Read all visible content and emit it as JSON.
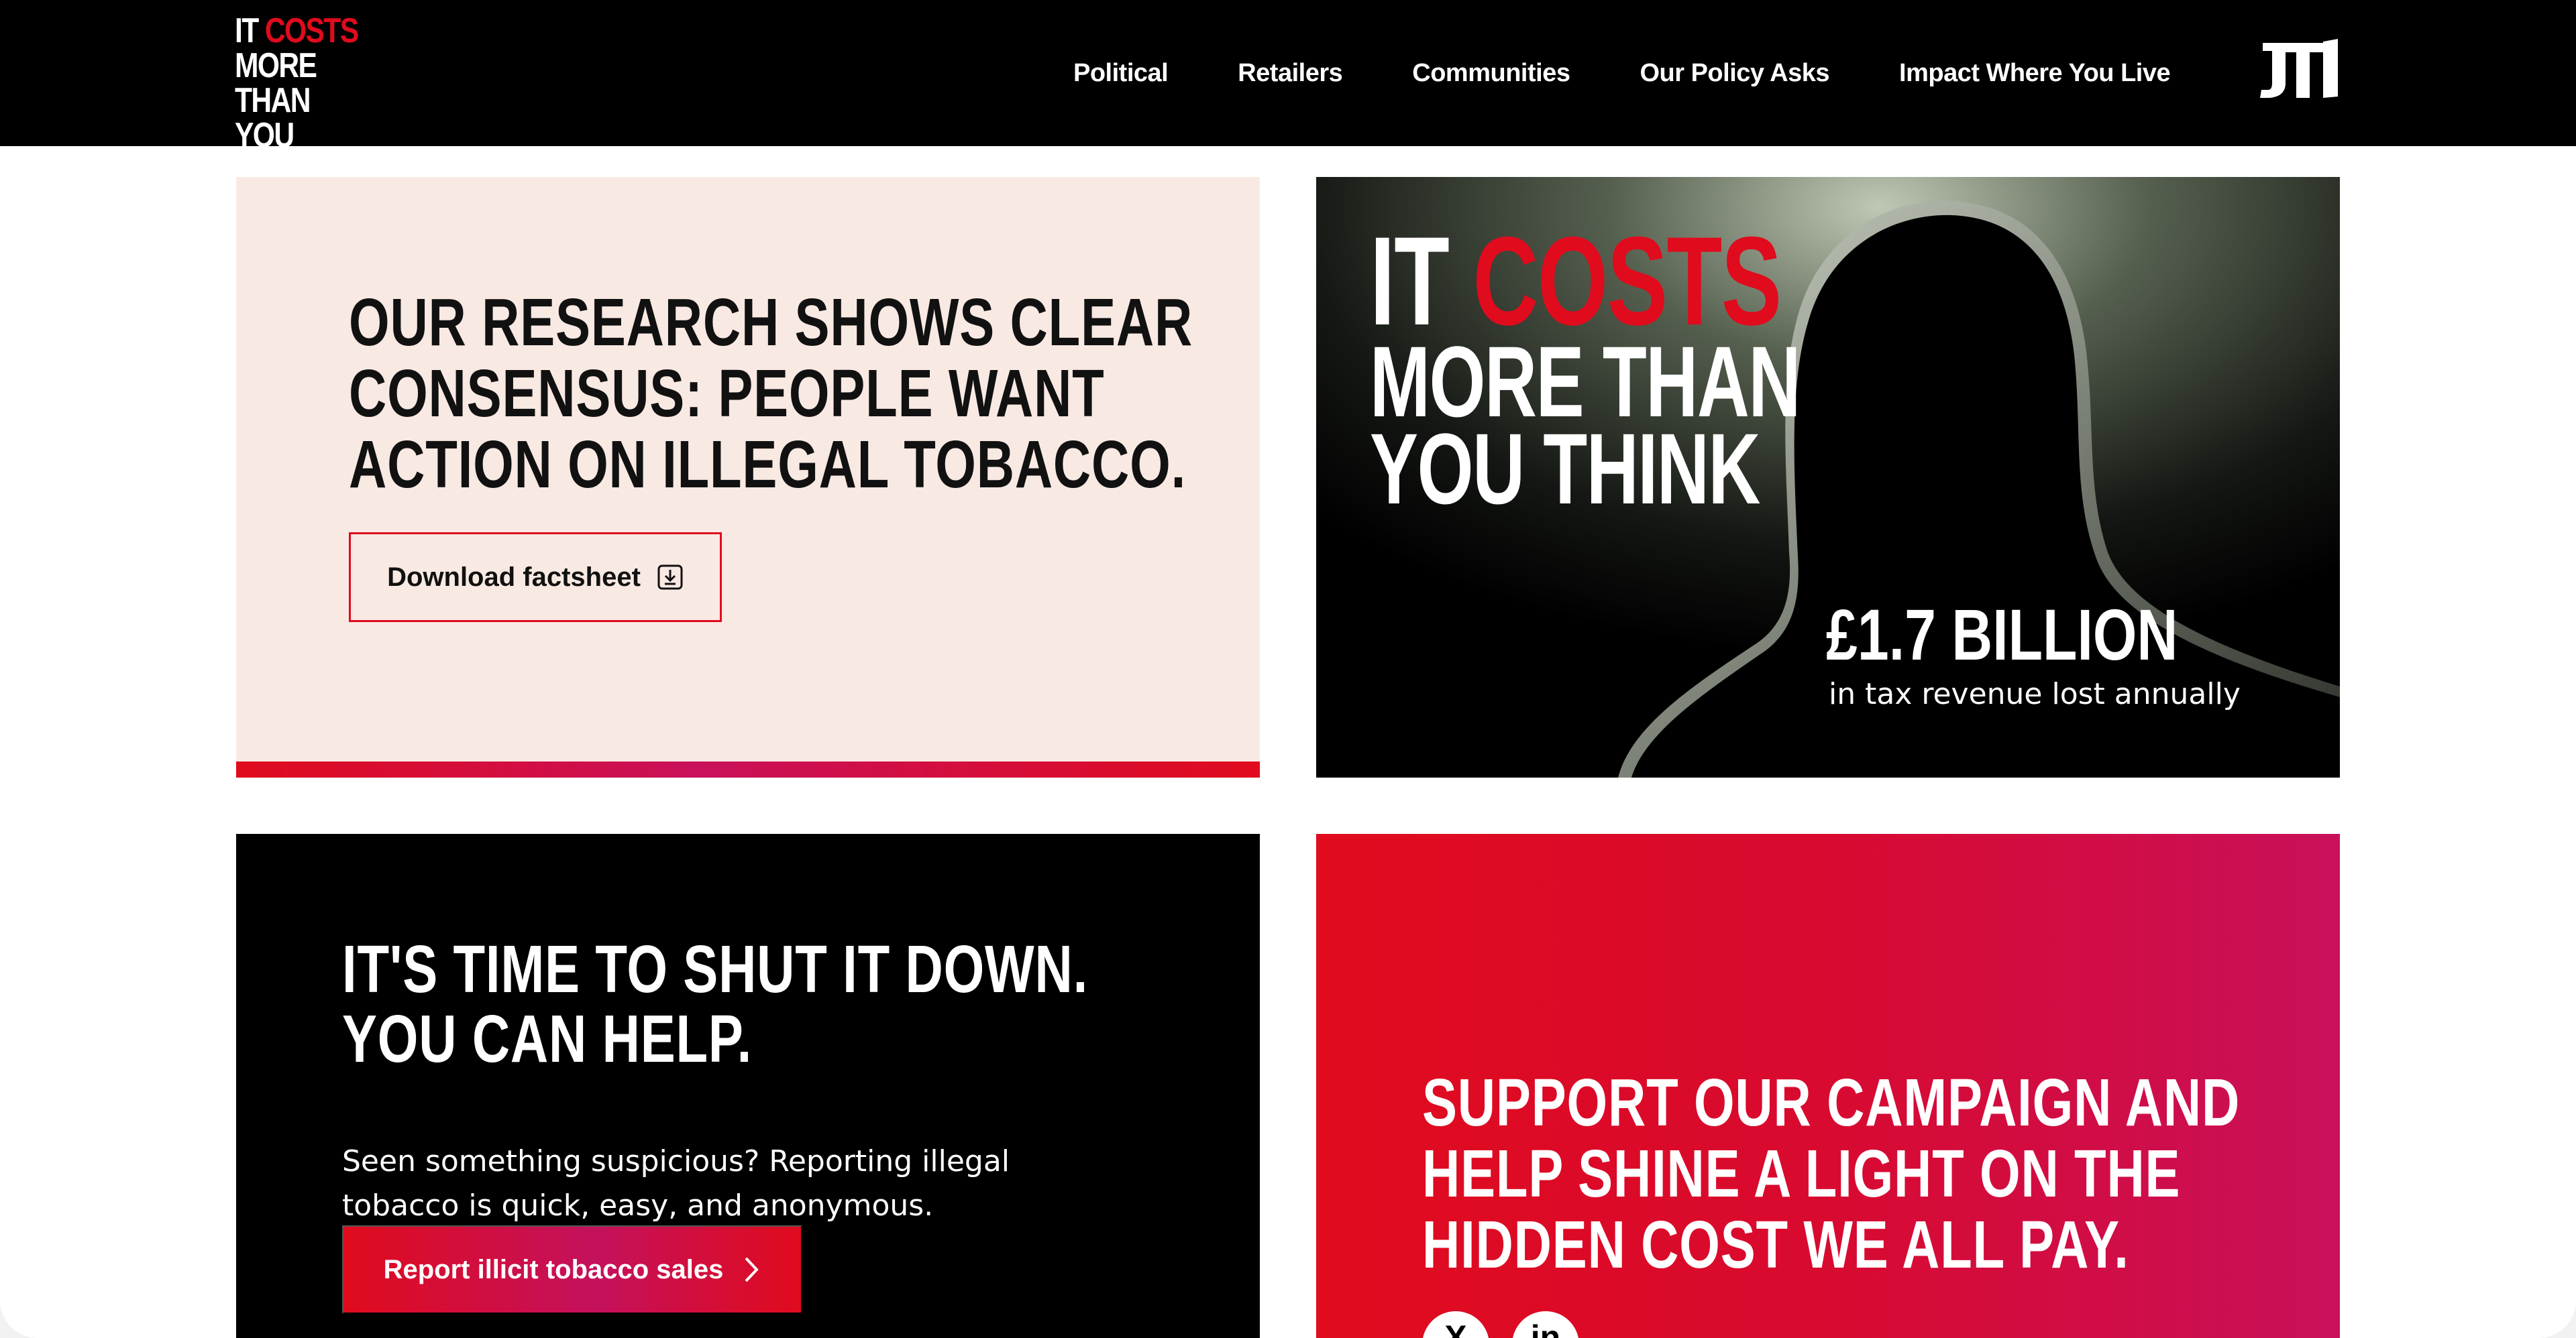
{
  "brand": {
    "logo_line1_a": "IT",
    "logo_line1_b": "COSTS",
    "logo_line2": "MORE THAN",
    "logo_line3": "YOU THINK",
    "company_mark": "JTI",
    "accent_color": "#e00b1d",
    "accent_color_2": "#c9105a"
  },
  "nav": {
    "items": [
      {
        "label": "Political"
      },
      {
        "label": "Retailers"
      },
      {
        "label": "Communities"
      },
      {
        "label": "Our Policy Asks"
      },
      {
        "label": "Impact Where You Live"
      }
    ]
  },
  "research_card": {
    "heading": "OUR RESEARCH SHOWS CLEAR CONSENSUS: PEOPLE WANT ACTION ON ILLEGAL TOBACCO.",
    "button_label": "Download factsheet",
    "button_icon": "download-icon"
  },
  "hero_card": {
    "title_a": "IT",
    "title_b": "COSTS",
    "title_line2": "MORE THAN",
    "title_line3": "YOU THINK",
    "stat_value": "£1.7 BILLION",
    "stat_caption": "in tax revenue lost annually",
    "image": "hooded-figure-silhouette"
  },
  "report_card": {
    "heading_line1": "IT'S TIME TO SHUT IT DOWN.",
    "heading_line2": "YOU CAN HELP.",
    "body": "Seen something suspicious? Reporting illegal tobacco is quick, easy, and anonymous.",
    "button_label": "Report illicit tobacco sales",
    "button_icon": "chevron-right-icon"
  },
  "campaign_card": {
    "heading": "SUPPORT OUR CAMPAIGN AND HELP SHINE A LIGHT ON THE HIDDEN COST WE ALL PAY.",
    "social": [
      {
        "icon": "x-icon"
      },
      {
        "icon": "linkedin-icon"
      }
    ]
  }
}
